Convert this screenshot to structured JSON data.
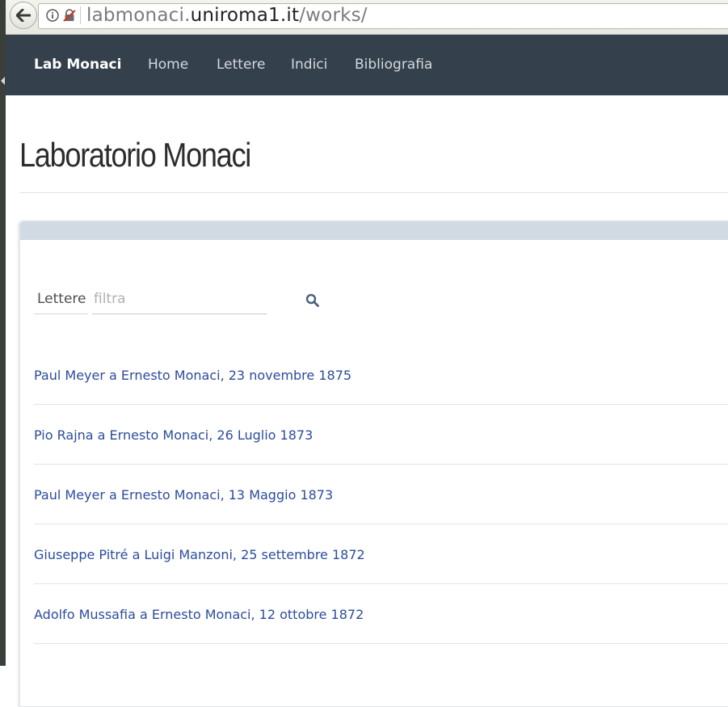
{
  "browser": {
    "url_prefix": "labmonaci.",
    "url_domain": "uniroma1.it",
    "url_path": "/works/"
  },
  "navbar": {
    "brand": "Lab Monaci",
    "items": [
      {
        "label": "Home"
      },
      {
        "label": "Lettere"
      },
      {
        "label": "Indici"
      },
      {
        "label": "Bibliografia"
      }
    ]
  },
  "page": {
    "title": "Laboratorio Monaci"
  },
  "filter": {
    "label": "Lettere",
    "placeholder": "filtra",
    "value": ""
  },
  "letters": [
    {
      "title": "Paul Meyer a Ernesto Monaci, 23 novembre 1875"
    },
    {
      "title": "Pio Rajna a Ernesto Monaci, 26 Luglio 1873"
    },
    {
      "title": "Paul Meyer a Ernesto Monaci, 13 Maggio 1873"
    },
    {
      "title": "Giuseppe Pitré a Luigi Manzoni, 25 settembre 1872"
    },
    {
      "title": "Adolfo Mussafia a Ernesto Monaci, 12 ottobre 1872"
    }
  ],
  "colors": {
    "navbar_bg": "#34404b",
    "panel_header": "#d1dae3",
    "link": "#2c4c9c"
  },
  "icons": {
    "back": "arrow-left-icon",
    "info": "info-icon",
    "lock": "insecure-lock-icon",
    "search": "search-icon"
  }
}
